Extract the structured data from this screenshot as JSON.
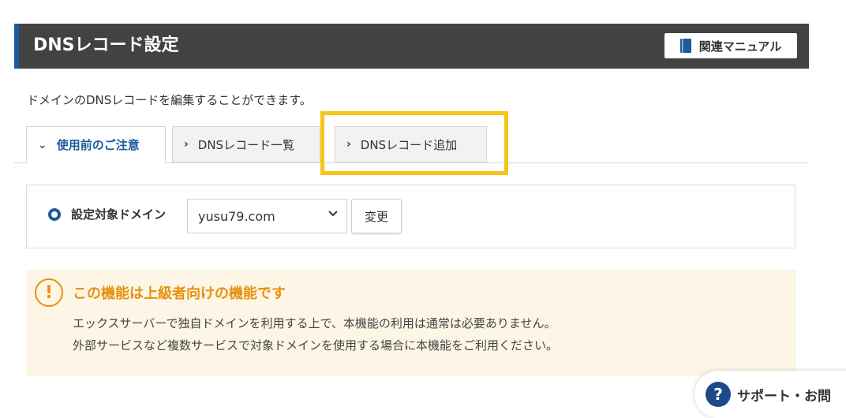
{
  "header": {
    "title": "DNSレコード設定",
    "manual_button": "関連マニュアル",
    "accent_color": "#1e5aa0",
    "bar_color": "#424242"
  },
  "description": "ドメインのDNSレコードを編集することができます。",
  "tabs": [
    {
      "label": "使用前のご注意",
      "active": true
    },
    {
      "label": "DNSレコード一覧",
      "active": false
    },
    {
      "label": "DNSレコード追加",
      "active": false
    }
  ],
  "highlight_color": "#f5c518",
  "domain": {
    "label": "設定対象ドメイン",
    "selected": "yusu79.com",
    "change_button": "変更"
  },
  "warning": {
    "icon": "!",
    "title": "この機能は上級者向けの機能です",
    "line1": "エックスサーバーで独自ドメインを利用する上で、本機能の利用は通常は必要ありません。",
    "line2": "外部サービスなど複数サービスで対象ドメインを使用する場合に本機能をご利用ください。",
    "color": "#e8900c"
  },
  "support": {
    "icon": "?",
    "label": "サポート・お問"
  }
}
